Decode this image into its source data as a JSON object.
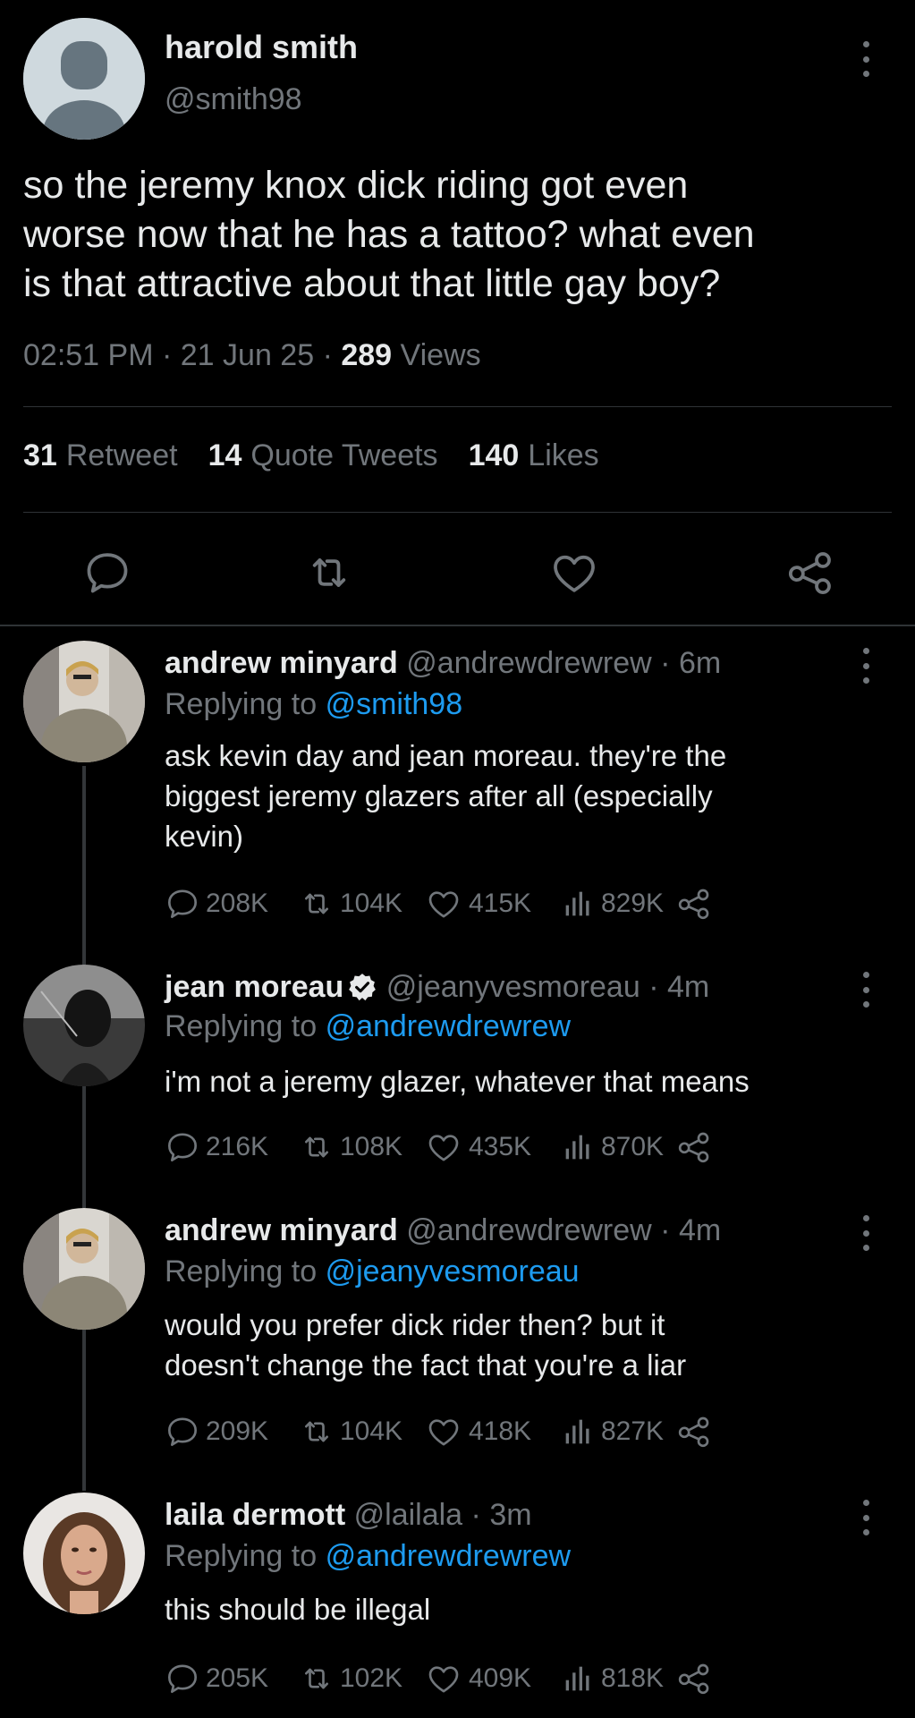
{
  "main_tweet": {
    "author_name": "harold smith",
    "author_handle": "@smith98",
    "text": "so the jeremy knox dick riding got even\nworse now that he has a tattoo? what even\nis that attractive about that little gay boy?",
    "time": "02:51 PM",
    "date": "21 Jun 25",
    "views_count": "289",
    "views_label": "Views",
    "retweets_count": "31",
    "retweets_label": "Retweet",
    "quotes_count": "14",
    "quotes_label": "Quote Tweets",
    "likes_count": "140",
    "likes_label": "Likes",
    "actions": [
      "reply-icon",
      "retweet-icon",
      "like-icon",
      "share-icon"
    ]
  },
  "replies": [
    {
      "name": "andrew minyard",
      "handle": "@andrewdrewrew",
      "time": "6m",
      "verified": false,
      "replying_prefix": "Replying to",
      "replying_to": "@smith98",
      "text": "ask kevin day and jean moreau. they're the\nbiggest jeremy glazers after all (especially\nkevin)",
      "replies": "208K",
      "retweets": "104K",
      "likes": "415K",
      "views": "829K"
    },
    {
      "name": "jean moreau",
      "handle": "@jeanyvesmoreau",
      "time": "4m",
      "verified": true,
      "replying_prefix": "Replying to",
      "replying_to": "@andrewdrewrew",
      "text": "i'm not a jeremy glazer, whatever that means",
      "replies": "216K",
      "retweets": "108K",
      "likes": "435K",
      "views": "870K"
    },
    {
      "name": "andrew minyard",
      "handle": "@andrewdrewrew",
      "time": "4m",
      "verified": false,
      "replying_prefix": "Replying to",
      "replying_to": "@jeanyvesmoreau",
      "text": "would you prefer dick rider then? but it\ndoesn't change the fact that you're a liar",
      "replies": "209K",
      "retweets": "104K",
      "likes": "418K",
      "views": "827K"
    },
    {
      "name": "laila dermott",
      "handle": "@lailala",
      "time": "3m",
      "verified": false,
      "replying_prefix": "Replying to",
      "replying_to": "@andrewdrewrew",
      "text": "this should be illegal",
      "replies": "205K",
      "retweets": "102K",
      "likes": "409K",
      "views": "818K"
    }
  ],
  "colors": {
    "background": "#000000",
    "text_primary": "#e7e9ea",
    "text_secondary": "#71767b",
    "link_blue": "#1d9bf0",
    "divider": "#2f3336"
  }
}
